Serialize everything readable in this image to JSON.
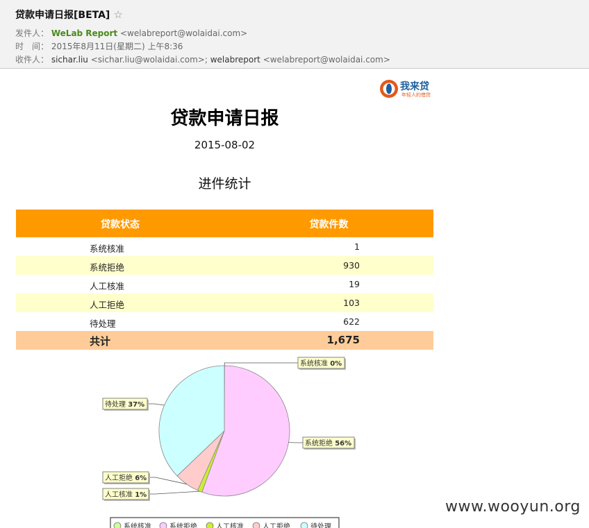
{
  "email": {
    "subject": "贷款申请日报[BETA]",
    "star_glyph": "☆",
    "from_label": "发件人：",
    "from_name": "WeLab Report",
    "from_address": "<welabreport@wolaidai.com>",
    "time_label": "时　间：",
    "time_value": "2015年8月11日(星期二) 上午8:36",
    "to_label": "收件人：",
    "to_name_1": "sichar.liu",
    "to_address_1": "<sichar.liu@wolaidai.com>;",
    "to_name_2": "welabreport",
    "to_address_2": "<welabreport@wolaidai.com>"
  },
  "logo": {
    "name": "我来贷",
    "slogan": "年轻人的借贷"
  },
  "report": {
    "title": "贷款申请日报",
    "date": "2015-08-02",
    "section_title": "进件统计"
  },
  "table": {
    "header_status": "贷款状态",
    "header_count": "贷款件数",
    "rows": [
      {
        "status": "系统核准",
        "count": "1"
      },
      {
        "status": "系统拒绝",
        "count": "930"
      },
      {
        "status": "人工核准",
        "count": "19"
      },
      {
        "status": "人工拒绝",
        "count": "103"
      },
      {
        "status": "待处理",
        "count": "622"
      }
    ],
    "total_label": "共计",
    "total_value": "1,675"
  },
  "chart_data": {
    "type": "pie",
    "title": "",
    "slices": [
      {
        "name": "系统核准",
        "value": 1,
        "label": "0%",
        "color": "#ccff99"
      },
      {
        "name": "系统拒绝",
        "value": 930,
        "label": "56%",
        "color": "#ffccff"
      },
      {
        "name": "人工核准",
        "value": 19,
        "label": "1%",
        "color": "#ccee33"
      },
      {
        "name": "人工拒绝",
        "value": 103,
        "label": "6%",
        "color": "#ffcccc"
      },
      {
        "name": "待处理",
        "value": 622,
        "label": "37%",
        "color": "#ccffff"
      }
    ],
    "legend": [
      "系统核准",
      "系统拒绝",
      "人工核准",
      "人工拒绝",
      "待处理"
    ],
    "legend_placement": "bottom"
  },
  "watermark": "www.wooyun.org"
}
